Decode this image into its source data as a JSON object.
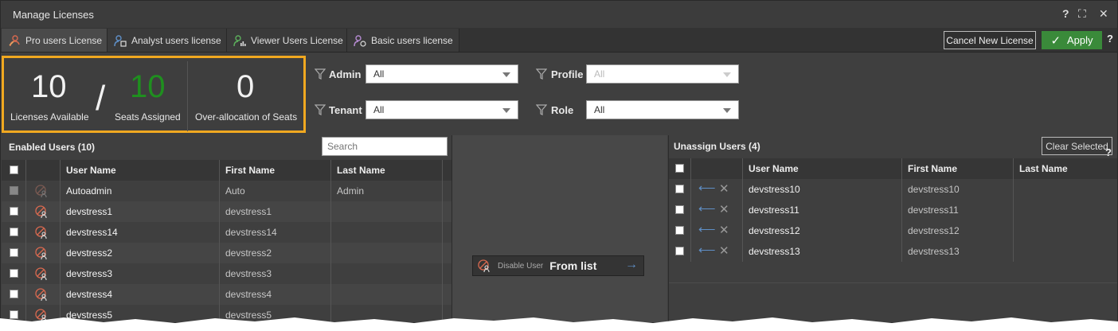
{
  "window": {
    "title": "Manage Licenses"
  },
  "titlebar_icons": [
    "help-icon",
    "maximize-icon",
    "close-icon"
  ],
  "titlebar_glyphs": {
    "help": "?",
    "maximize": "⛶",
    "close": "✕"
  },
  "tabs": [
    {
      "label": "Pro users License",
      "icon": "pro-user-icon",
      "active": true
    },
    {
      "label": "Analyst users license",
      "icon": "analyst-user-icon",
      "active": false
    },
    {
      "label": "Viewer Users License",
      "icon": "viewer-user-icon",
      "active": false
    },
    {
      "label": "Basic users license",
      "icon": "basic-user-icon",
      "active": false
    }
  ],
  "actions": {
    "cancel_label": "Cancel New License",
    "apply_label": "Apply",
    "help_label": "?"
  },
  "stats": {
    "licenses_available": {
      "value": "10",
      "label": "Licenses Available"
    },
    "separator": "/",
    "seats_assigned": {
      "value": "10",
      "label": "Seats Assigned"
    },
    "over_allocation": {
      "value": "0",
      "label": "Over-allocation of Seats"
    }
  },
  "filters": {
    "admin": {
      "label": "Admin",
      "value": "All"
    },
    "tenant": {
      "label": "Tenant",
      "value": "All"
    },
    "profile": {
      "label": "Profile",
      "value": "All",
      "disabled": true
    },
    "role": {
      "label": "Role",
      "value": "All"
    }
  },
  "enabled_users": {
    "title": "Enabled Users (10)",
    "search_placeholder": "Search",
    "columns": [
      "User Name",
      "First Name",
      "Last Name"
    ],
    "rows": [
      {
        "user": "Autoadmin",
        "first": "Auto",
        "last": "Admin",
        "disabled": true
      },
      {
        "user": "devstress1",
        "first": "devstress1",
        "last": ""
      },
      {
        "user": "devstress14",
        "first": "devstress14",
        "last": ""
      },
      {
        "user": "devstress2",
        "first": "devstress2",
        "last": ""
      },
      {
        "user": "devstress3",
        "first": "devstress3",
        "last": ""
      },
      {
        "user": "devstress4",
        "first": "devstress4",
        "last": ""
      },
      {
        "user": "devstress5",
        "first": "devstress5",
        "last": ""
      }
    ]
  },
  "middle": {
    "disable_label": "Disable User",
    "from_label": "From list",
    "arrow": "→"
  },
  "unassign_users": {
    "title": "Unassign Users (4)",
    "clear_label": "Clear Selected",
    "help_label": "?",
    "columns": [
      "User Name",
      "First Name",
      "Last Name"
    ],
    "rows": [
      {
        "user": "devstress10",
        "first": "devstress10",
        "last": ""
      },
      {
        "user": "devstress11",
        "first": "devstress11",
        "last": ""
      },
      {
        "user": "devstress12",
        "first": "devstress12",
        "last": ""
      },
      {
        "user": "devstress13",
        "first": "devstress13",
        "last": ""
      }
    ],
    "row_action_glyphs": {
      "move": "⟵",
      "remove": "✕"
    }
  },
  "colors": {
    "accent": "#f0a820",
    "apply": "#3a8a3a",
    "seats_green": "#1f8f1f",
    "user_icon": "#d9694f",
    "arrow_blue": "#5f8fc7"
  }
}
